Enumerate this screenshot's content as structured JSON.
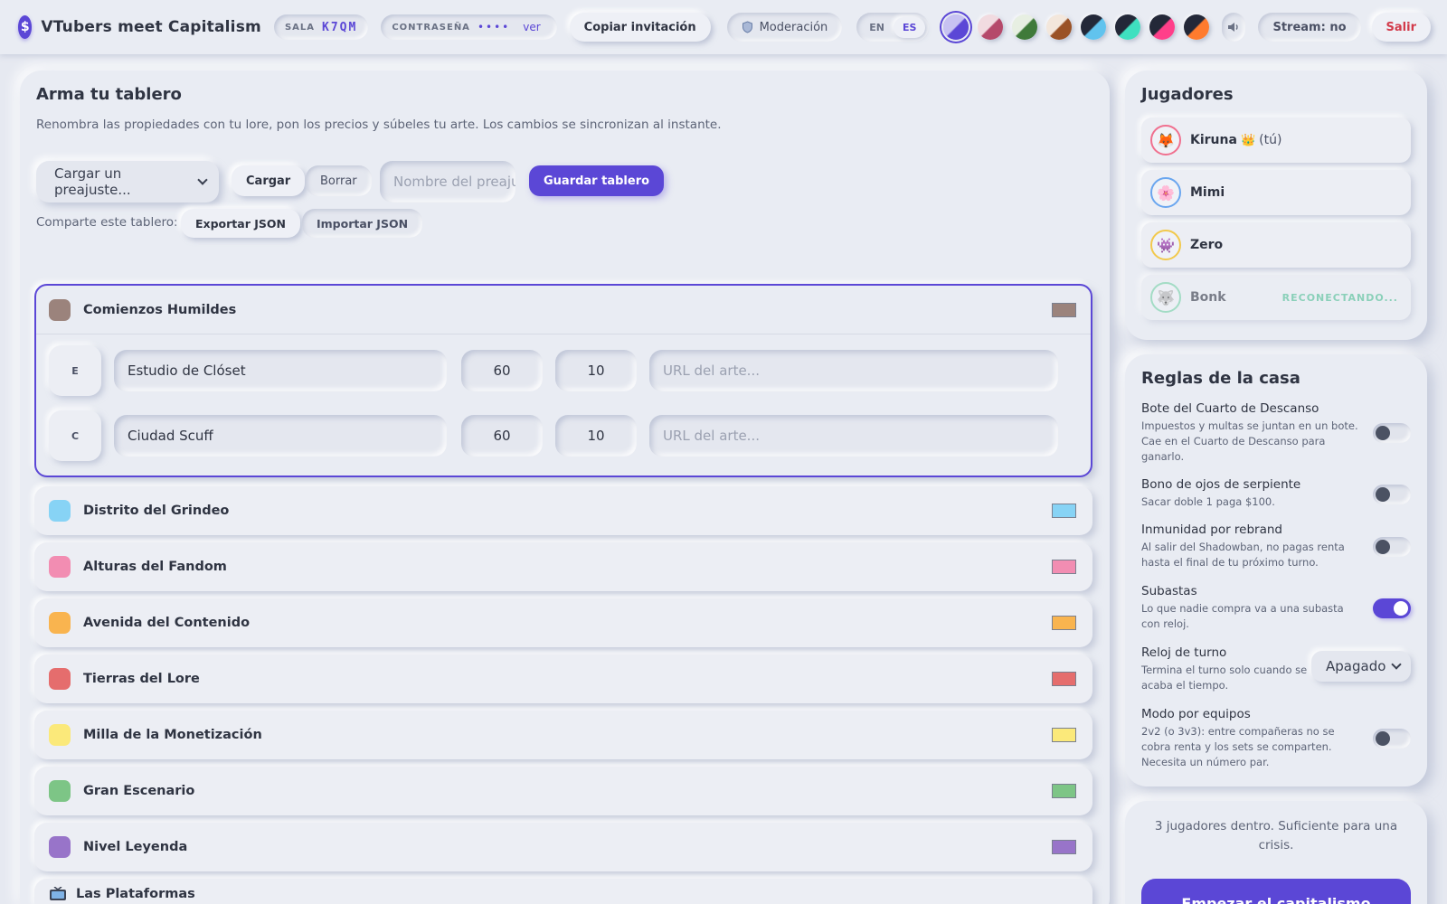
{
  "app": {
    "title": "VTubers meet Capitalism",
    "logo_glyph": "$"
  },
  "room": {
    "label": "SALA",
    "code": "K7QM"
  },
  "password": {
    "label": "CONTRASEÑA",
    "dots": "••••",
    "show_label": "ver"
  },
  "header": {
    "copy_invite": "Copiar invitación",
    "moderation": "Moderación",
    "lang_en": "EN",
    "lang_es": "ES",
    "stream_label": "Stream: no",
    "leave": "Salir",
    "sound_icon": "speaker-icon",
    "shield_icon": "shield-icon"
  },
  "themes": [
    {
      "name": "theme-lavender",
      "a": "#c7c2f2",
      "b": "#5b47d6",
      "selected": true
    },
    {
      "name": "theme-rose",
      "a": "#f1dbe0",
      "b": "#b5496a",
      "selected": false
    },
    {
      "name": "theme-forest",
      "a": "#e7efe2",
      "b": "#3f7a3a",
      "selected": false
    },
    {
      "name": "theme-copper",
      "a": "#f3e7dc",
      "b": "#9a5226",
      "selected": false
    },
    {
      "name": "theme-ice",
      "a": "#232838",
      "b": "#61c3ee",
      "selected": false
    },
    {
      "name": "theme-mint",
      "a": "#232838",
      "b": "#3fe0c0",
      "selected": false
    },
    {
      "name": "theme-pink",
      "a": "#232838",
      "b": "#ff3f8a",
      "selected": false
    },
    {
      "name": "theme-orange",
      "a": "#232838",
      "b": "#ff7b2e",
      "selected": false
    }
  ],
  "board": {
    "title": "Arma tu tablero",
    "subtitle": "Renombra las propiedades con tu lore, pon los precios y súbeles tu arte. Los cambios se sincronizan al instante.",
    "preset_select": "Cargar un preajuste...",
    "load": "Cargar",
    "delete": "Borrar",
    "preset_name_placeholder": "Nombre del preajuste",
    "save": "Guardar tablero",
    "share_label": "Comparte este tablero:",
    "export": "Exportar JSON",
    "import": "Importar JSON",
    "art_placeholder": "URL del arte...",
    "groups": [
      {
        "name": "Comienzos Humildes",
        "color": "#9b837c",
        "expanded": true,
        "properties": [
          {
            "tile": "E",
            "name": "Estudio de Clóset",
            "price": "60",
            "rent": "10"
          },
          {
            "tile": "C",
            "name": "Ciudad Scuff",
            "price": "60",
            "rent": "10"
          }
        ]
      },
      {
        "name": "Distrito del Grindeo",
        "color": "#87d3f5"
      },
      {
        "name": "Alturas del Fandom",
        "color": "#f28db2"
      },
      {
        "name": "Avenida del Contenido",
        "color": "#f9b44f"
      },
      {
        "name": "Tierras del Lore",
        "color": "#e56d6d"
      },
      {
        "name": "Milla de la Monetización",
        "color": "#fbe97a"
      },
      {
        "name": "Gran Escenario",
        "color": "#7dc586"
      },
      {
        "name": "Nivel Leyenda",
        "color": "#9874c9"
      }
    ],
    "partial_group": {
      "icon": "tv-icon",
      "name": "Las Plataformas"
    }
  },
  "players": {
    "title": "Jugadores",
    "list": [
      {
        "name": "Kiruna",
        "crown": "👑",
        "you": "(tú)",
        "emoji": "🦊",
        "ring": "#f0708f",
        "status": ""
      },
      {
        "name": "Mimi",
        "crown": "",
        "you": "",
        "emoji": "🌸",
        "ring": "#6aa6ef",
        "status": ""
      },
      {
        "name": "Zero",
        "crown": "",
        "you": "",
        "emoji": "👾",
        "ring": "#f2c94c",
        "status": ""
      },
      {
        "name": "Bonk",
        "crown": "",
        "you": "",
        "emoji": "🐺",
        "ring": "#76d3a7",
        "status": "RECONECTANDO..."
      }
    ]
  },
  "rules": {
    "title": "Reglas de la casa",
    "items": [
      {
        "title": "Bote del Cuarto de Descanso",
        "desc": "Impuestos y multas se juntan en un bote. Cae en el Cuarto de Descanso para ganarlo.",
        "control": "toggle",
        "on": false
      },
      {
        "title": "Bono de ojos de serpiente",
        "desc": "Sacar doble 1 paga $100.",
        "control": "toggle",
        "on": false
      },
      {
        "title": "Inmunidad por rebrand",
        "desc": "Al salir del Shadowban, no pagas renta hasta el final de tu próximo turno.",
        "control": "toggle",
        "on": false
      },
      {
        "title": "Subastas",
        "desc": "Lo que nadie compra va a una subasta con reloj.",
        "control": "toggle",
        "on": true
      },
      {
        "title": "Reloj de turno",
        "desc": "Termina el turno solo cuando se acaba el tiempo.",
        "control": "select",
        "value": "Apagado"
      },
      {
        "title": "Modo por equipos",
        "desc": "2v2 (o 3v3): entre compañeras no se cobra renta y los sets se comparten. Necesita un número par.",
        "control": "toggle",
        "on": false
      }
    ]
  },
  "start": {
    "message": "3 jugadores dentro. Suficiente para una crisis.",
    "button": "Empezar el capitalismo"
  },
  "colors": {
    "accent": "#5b47d6",
    "danger": "#d23a4a",
    "success": "#4cbf93"
  }
}
